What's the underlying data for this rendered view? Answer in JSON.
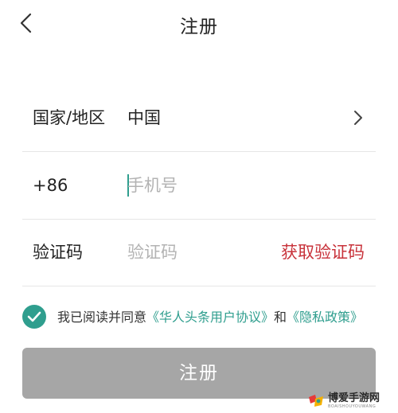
{
  "header": {
    "title": "注册",
    "back_icon": "chevron-left-icon"
  },
  "form": {
    "country": {
      "label": "国家/地区",
      "value": "中国",
      "chevron_icon": "chevron-right-icon"
    },
    "phone": {
      "prefix": "+86",
      "value": "",
      "placeholder": "手机号"
    },
    "code": {
      "label": "验证码",
      "value": "",
      "placeholder": "验证码",
      "get_code_label": "获取验证码"
    }
  },
  "agreement": {
    "checked": true,
    "text_before": "我已阅读并同意",
    "user_agreement": "《华人头条用户协议》",
    "connector": "和",
    "privacy_policy": "《隐私政策》"
  },
  "submit": {
    "label": "注册"
  },
  "watermark": {
    "name": "博爱手游网",
    "sub": "BOAISHOUYOUWANG"
  },
  "colors": {
    "accent": "#2f9e8e",
    "danger": "#c8323a",
    "button_disabled": "#a6a6a6"
  }
}
